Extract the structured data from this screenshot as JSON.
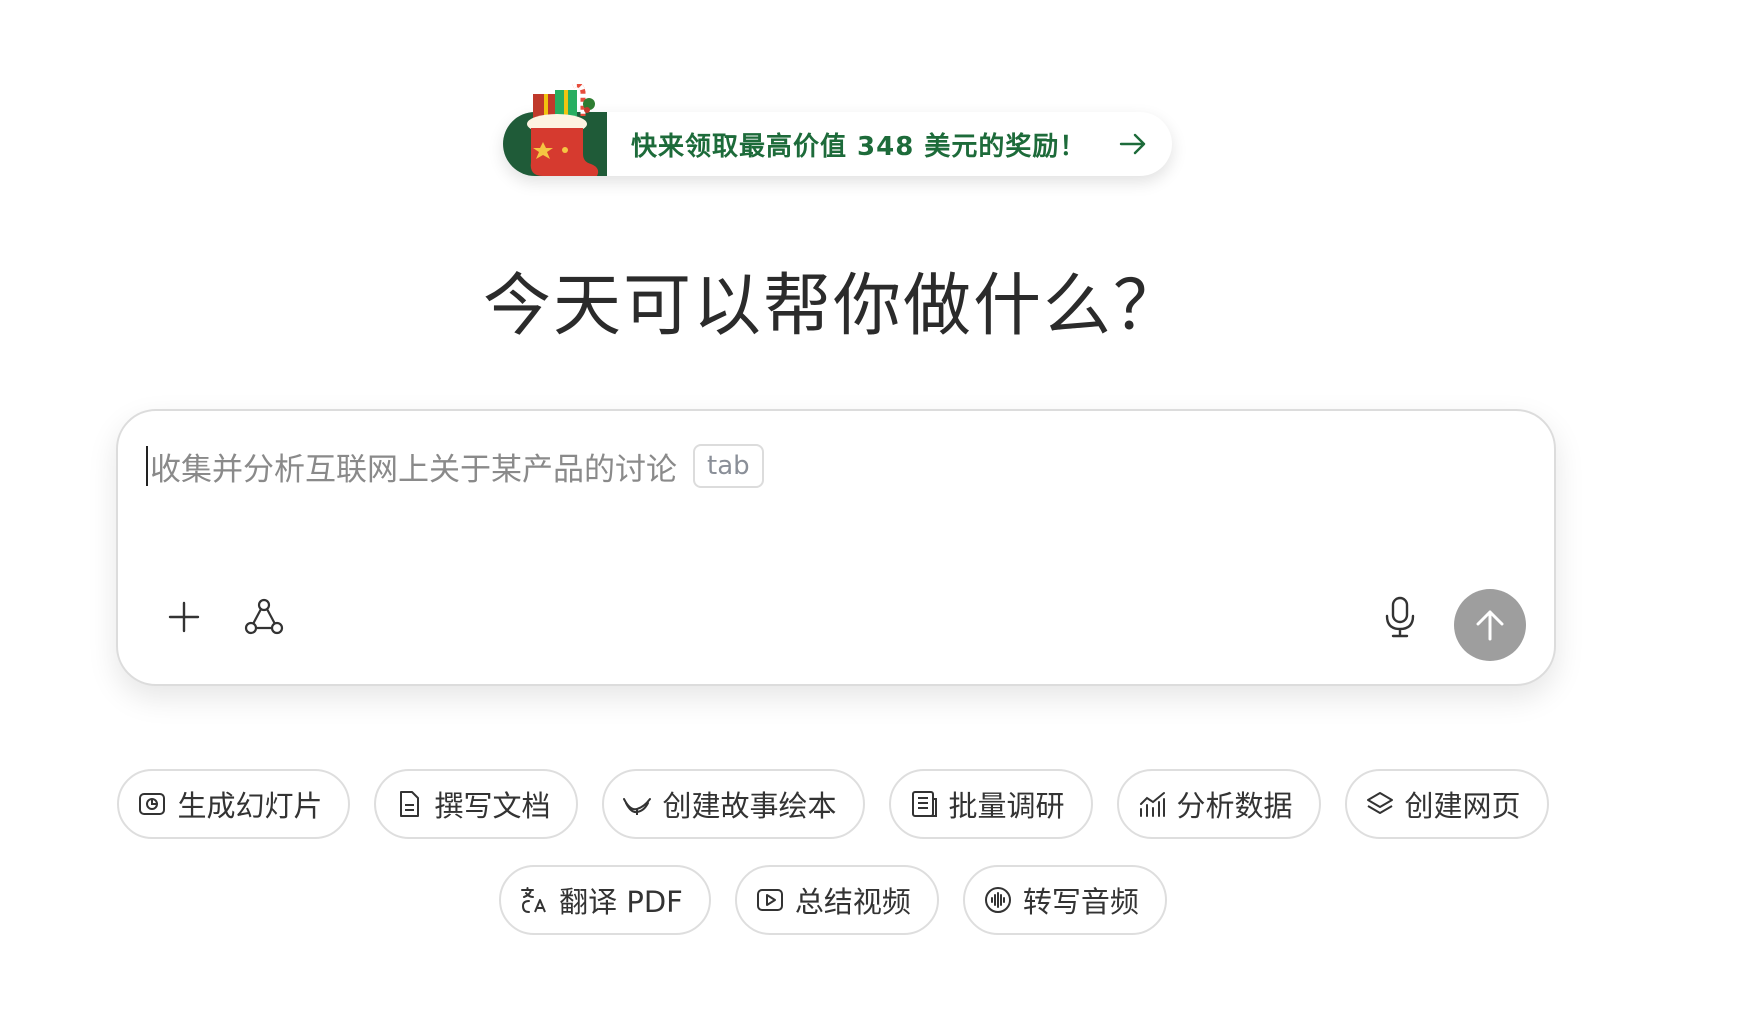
{
  "promo": {
    "text": "快来领取最高价值 348 美元的奖励！",
    "accent_color": "#1d6b3a",
    "icon": "christmas-stocking-icon",
    "arrow_icon": "arrow-right-icon"
  },
  "headline": "今天可以帮你做什么？",
  "composer": {
    "placeholder": "收集并分析互联网上关于某产品的讨论",
    "tab_hint": "tab",
    "tools": [
      "plus-icon",
      "workflow-icon"
    ],
    "voice_icon": "microphone-icon",
    "send_icon": "arrow-up-icon"
  },
  "suggestions": {
    "row1": [
      {
        "label": "生成幻灯片",
        "icon": "slides-icon"
      },
      {
        "label": "撰写文档",
        "icon": "document-icon"
      },
      {
        "label": "创建故事绘本",
        "icon": "storybook-icon"
      },
      {
        "label": "批量调研",
        "icon": "research-icon"
      },
      {
        "label": "分析数据",
        "icon": "chart-icon"
      },
      {
        "label": "创建网页",
        "icon": "webpage-icon"
      }
    ],
    "row2": [
      {
        "label": "翻译 PDF",
        "icon": "translate-icon"
      },
      {
        "label": "总结视频",
        "icon": "video-icon"
      },
      {
        "label": "转写音频",
        "icon": "audio-wave-icon"
      }
    ]
  }
}
